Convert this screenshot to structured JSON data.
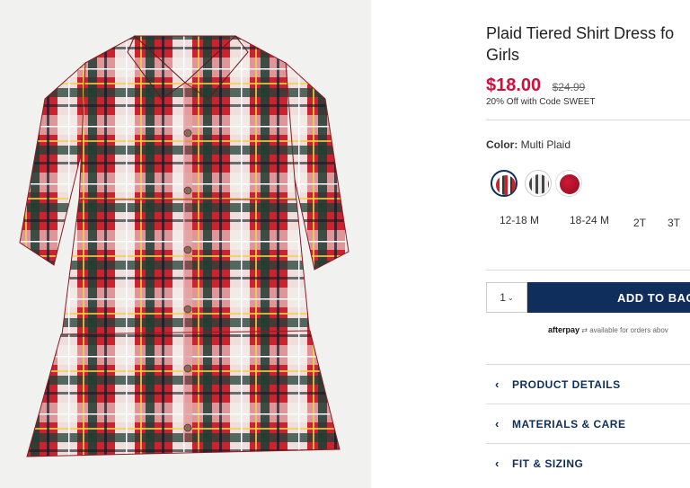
{
  "product": {
    "title_line1": "Plaid Tiered Shirt Dress fo",
    "title_line2": "Girls",
    "sale_price": "$18.00",
    "original_price": "$24.99",
    "promo": "20% Off with Code SWEET",
    "color_label": "Color:",
    "color_value": "Multi Plaid",
    "swatches": [
      {
        "name": "Multi Plaid",
        "color": "#c23038",
        "selected": true
      },
      {
        "name": "Gray Plaid",
        "color": "#9a9a9a",
        "selected": false
      },
      {
        "name": "Red",
        "color": "#b3102a",
        "selected": false
      }
    ],
    "sizes": [
      "12-18 M",
      "18-24 M",
      "2T",
      "3T"
    ],
    "quantity": "1",
    "add_to_bag": "ADD TO BAG",
    "afterpay_brand": "afterpay",
    "afterpay_text": "available for orders abov",
    "accordion": [
      "PRODUCT DETAILS",
      "MATERIALS & CARE",
      "FIT & SIZING"
    ]
  },
  "colors": {
    "sale": "#d0103a",
    "brand_navy": "#0f2e5c",
    "plaid_red": "#c8232f",
    "plaid_green": "#1f4a3a",
    "plaid_white": "#f4f3ef"
  }
}
